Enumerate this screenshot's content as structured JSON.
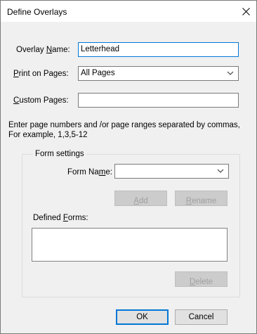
{
  "window": {
    "title": "Define Overlays"
  },
  "overlay_name": {
    "label_before": "Overlay ",
    "label_u": "N",
    "label_after": "ame:",
    "value": "Letterhead"
  },
  "print_on_pages": {
    "label_u": "P",
    "label_after": "rint on Pages:",
    "value": "All Pages"
  },
  "custom_pages": {
    "label_u": "C",
    "label_after": "ustom Pages:",
    "value": ""
  },
  "hint": {
    "line1": "Enter page numbers and /or page ranges separated by commas,",
    "line2": "For example, 1,3,5-12"
  },
  "form_settings": {
    "title": "Form settings",
    "form_name": {
      "label_before": "Form Na",
      "label_u": "m",
      "label_after": "e:",
      "value": ""
    },
    "add_label_u": "A",
    "add_label_after": "dd",
    "rename_label_u": "R",
    "rename_label_after": "ename",
    "defined_forms": {
      "label_before": "Defined ",
      "label_u": "F",
      "label_after": "orms:"
    },
    "delete_label_u": "D",
    "delete_label_after": "elete"
  },
  "buttons": {
    "ok": "OK",
    "cancel": "Cancel"
  },
  "icons": {
    "close": "close-icon",
    "dropdown": "chevron-down-icon"
  }
}
